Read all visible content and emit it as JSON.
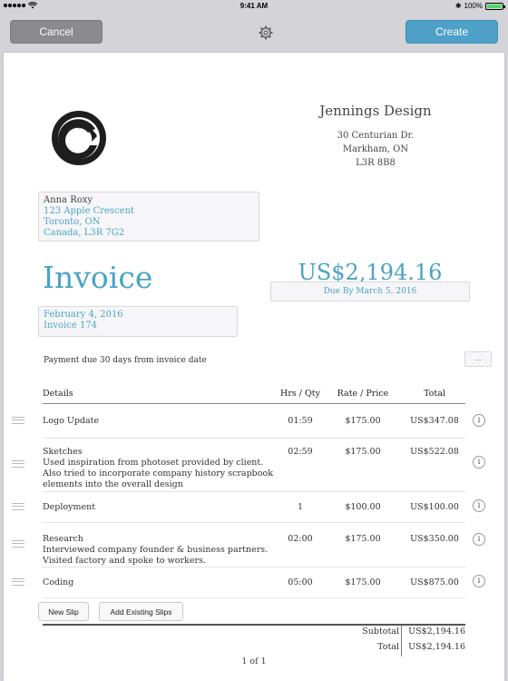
{
  "status_bar": {
    "time": "9:41 AM",
    "battery": "100%",
    "battery_level": 1.0
  },
  "toolbar": {
    "cancel_label": "Cancel",
    "create_label": "Create",
    "settings_icon": "gear-icon"
  },
  "company": {
    "name": "Jennings Design",
    "address_lines": [
      "30 Centurian Dr.",
      "Markham, ON",
      "L3R 8B8"
    ]
  },
  "client": {
    "name": "Anna Roxy",
    "street": "123 Apple Crescent",
    "city": "Toronto, ON",
    "country": "Canada, L3R 7G2"
  },
  "invoice": {
    "title": "Invoice",
    "amount": "US$2,194.16",
    "due": "Due By March 5, 2016",
    "date": "February 4, 2016",
    "number": "Invoice 174",
    "terms": "Payment due 30 days from invoice date",
    "more_label": "..."
  },
  "table": {
    "headers": {
      "details": "Details",
      "hrs": "Hrs / Qty",
      "rate": "Rate / Price",
      "total": "Total"
    },
    "rows": [
      {
        "title": "Logo Update",
        "desc": "",
        "hrs": "01:59",
        "rate": "$175.00",
        "total": "US$347.08"
      },
      {
        "title": "Sketches",
        "desc": "Used inspiration from photoset provided by client. Also tried to incorporate company history scrapbook elements into the overall design",
        "hrs": "02:59",
        "rate": "$175.00",
        "total": "US$522.08"
      },
      {
        "title": "Deployment",
        "desc": "",
        "hrs": "1",
        "rate": "$100.00",
        "total": "US$100.00"
      },
      {
        "title": "Research",
        "desc": "Interviewed company founder & business partners. Visited factory and spoke to workers.",
        "hrs": "02:00",
        "rate": "$175.00",
        "total": "US$350.00"
      },
      {
        "title": "Coding",
        "desc": "",
        "hrs": "05:00",
        "rate": "$175.00",
        "total": "US$875.00"
      }
    ],
    "info_label": "i"
  },
  "actions": {
    "new_slip": "New Slip",
    "add_existing": "Add Existing Slips"
  },
  "totals": {
    "subtotal_label": "Subtotal",
    "subtotal": "US$2,194.16",
    "total_label": "Total",
    "total": "US$2,194.16"
  },
  "pager": "1 of 1",
  "colors": {
    "accent": "#4aa3c7",
    "create_button": "#4ea0c8",
    "cancel_button": "#8a8a90"
  }
}
